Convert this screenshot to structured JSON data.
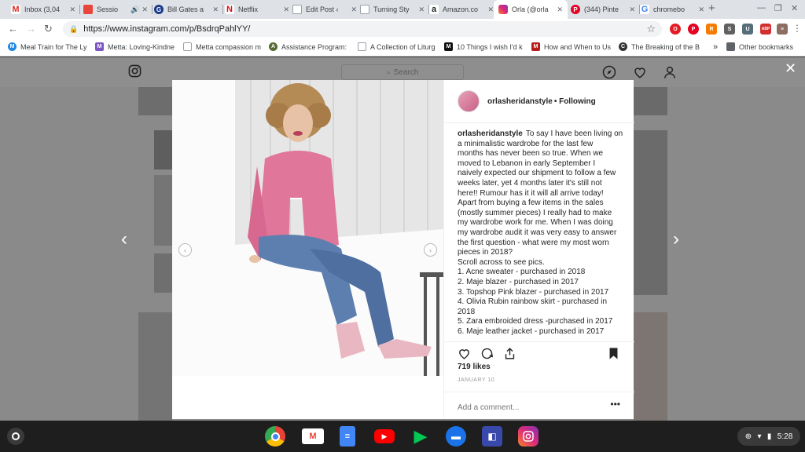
{
  "browser": {
    "tabs": [
      {
        "title": "Inbox (3,04",
        "icon": "gmail-icon",
        "color": "#d93025",
        "glyph": "M"
      },
      {
        "title": "Sessio",
        "icon": "recorder-icon",
        "color": "#e8453c",
        "glyph": "",
        "audio": "🔊"
      },
      {
        "title": "Bill Gates a",
        "icon": "site-icon",
        "color": "#1a3a8a",
        "glyph": "G"
      },
      {
        "title": "Netflix",
        "icon": "netflix-icon",
        "color": "#e50914",
        "glyph": "N"
      },
      {
        "title": "Edit Post ‹",
        "icon": "page-icon",
        "color": "#9aa0a6",
        "glyph": ""
      },
      {
        "title": "Turning Sty",
        "icon": "page-icon",
        "color": "#9aa0a6",
        "glyph": ""
      },
      {
        "title": "Amazon.co",
        "icon": "amazon-icon",
        "color": "#222222",
        "glyph": "a"
      },
      {
        "title": "Orla (@orla",
        "icon": "instagram-icon",
        "color": "#c13584",
        "glyph": "",
        "active": true
      },
      {
        "title": "(344) Pinte",
        "icon": "pinterest-icon",
        "color": "#e60023",
        "glyph": "P"
      },
      {
        "title": "chromebo",
        "icon": "google-icon",
        "color": "#4285f4",
        "glyph": "G"
      }
    ],
    "url": "https://www.instagram.com/p/BsdrqPahlYY/",
    "bookmarks": [
      {
        "label": "Meal Train for The Ly",
        "color": "#1e88e5",
        "glyph": "M"
      },
      {
        "label": "Metta: Loving-Kindne",
        "color": "#7e57c2",
        "glyph": "M"
      },
      {
        "label": "Metta compassion m",
        "color": "#bdbdbd",
        "glyph": ""
      },
      {
        "label": "Assistance Program:",
        "color": "#556b2f",
        "glyph": "A"
      },
      {
        "label": "A Collection of Liturg",
        "color": "#bdbdbd",
        "glyph": ""
      },
      {
        "label": "10 Things I wish I'd k",
        "color": "#111111",
        "glyph": "M"
      },
      {
        "label": "How and When to Us",
        "color": "#b71c1c",
        "glyph": "M"
      },
      {
        "label": "The Breaking of the B",
        "color": "#333333",
        "glyph": "C"
      }
    ],
    "bookmarks_more": "»",
    "other_bookmarks": "Other bookmarks",
    "extensions": [
      {
        "name": "opera-icon",
        "color": "#e31c23",
        "glyph": "O"
      },
      {
        "name": "pinterest-ext-icon",
        "color": "#e60023",
        "glyph": "P"
      },
      {
        "name": "rss-icon",
        "color": "#f57c00",
        "glyph": "R"
      },
      {
        "name": "shield-ext-icon",
        "color": "#616161",
        "glyph": "S"
      },
      {
        "name": "readlater-icon",
        "color": "#546e7a",
        "glyph": "U"
      },
      {
        "name": "adblock-icon",
        "color": "#d32f2f",
        "glyph": "ABP"
      },
      {
        "name": "stack-ext-icon",
        "color": "#8d6e63",
        "glyph": "≡"
      }
    ]
  },
  "instagram": {
    "search_placeholder": "Search",
    "post": {
      "username": "orlasheridanstyle",
      "follow_text": "• Following",
      "caption_lines": [
        "To say I have been living on",
        "a minimalistic wardrobe for the last few",
        "months has never been so true. When we",
        "moved to Lebanon in early September I",
        "naively expected our shipment to follow a few",
        "weeks later, yet 4 months later it's still not",
        "here!! Rumour has it it will all arrive today!",
        "Apart from buying a few items in the sales",
        "(mostly summer pieces) I really had to make",
        "my wardrobe work for me. When I was doing",
        "my wardrobe audit it was very easy to answer",
        "the first question - what were my most worn",
        "pieces in 2018?",
        "Scroll across to see pics.",
        "1. Acne sweater - purchased in 2018",
        "2. Maje blazer - purchased in 2017",
        "3. Topshop Pink blazer - purchased in 2017",
        "4. Olivia Rubin rainbow skirt - purchased in",
        "2018",
        "5. Zara embroided dress -purchased in 2017",
        "6. Maje leather jacket - purchased in 2017"
      ],
      "likes": "719 likes",
      "date": "JANUARY 10",
      "comment_placeholder": "Add a comment...",
      "more": "•••"
    }
  },
  "shelf": {
    "apps": [
      {
        "name": "chrome-app-icon",
        "color": "#4285f4"
      },
      {
        "name": "gmail-app-icon",
        "color": "#ea4335"
      },
      {
        "name": "docs-app-icon",
        "color": "#4285f4"
      },
      {
        "name": "youtube-app-icon",
        "color": "#ff0000"
      },
      {
        "name": "play-store-app-icon",
        "color": "#00c853"
      },
      {
        "name": "files-app-icon",
        "color": "#1a73e8"
      },
      {
        "name": "screencast-app-icon",
        "color": "#3949ab"
      },
      {
        "name": "instagram-app-icon",
        "color": "#c13584"
      }
    ],
    "time": "5:28"
  }
}
